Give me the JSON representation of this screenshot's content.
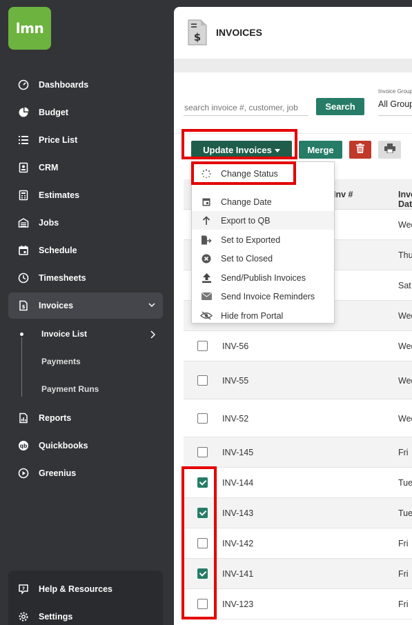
{
  "app": {
    "logo_text": "lmn"
  },
  "sidebar": {
    "items": [
      {
        "label": "Dashboards",
        "icon": "gauge-icon"
      },
      {
        "label": "Budget",
        "icon": "pie-chart-icon"
      },
      {
        "label": "Price List",
        "icon": "list-icon"
      },
      {
        "label": "CRM",
        "icon": "contact-card-icon"
      },
      {
        "label": "Estimates",
        "icon": "calculator-icon"
      },
      {
        "label": "Jobs",
        "icon": "jobs-icon"
      },
      {
        "label": "Schedule",
        "icon": "calendar-icon"
      },
      {
        "label": "Timesheets",
        "icon": "clock-icon"
      },
      {
        "label": "Invoices",
        "icon": "invoice-icon"
      },
      {
        "label": "Reports",
        "icon": "report-icon"
      },
      {
        "label": "Quickbooks",
        "icon": "quickbooks-icon"
      },
      {
        "label": "Greenius",
        "icon": "play-circle-icon"
      }
    ],
    "invoice_sub": [
      "Invoice List",
      "Payments",
      "Payment Runs"
    ],
    "bottom": [
      {
        "label": "Help & Resources",
        "icon": "help-icon"
      },
      {
        "label": "Settings",
        "icon": "gear-icon"
      }
    ]
  },
  "header": {
    "title": "INVOICES"
  },
  "filters": {
    "search_placeholder": "search invoice #, customer, job",
    "search_label": "Search",
    "group_label": "Invoice Group",
    "group_value": "All Groups"
  },
  "toolbar": {
    "update_label": "Update Invoices",
    "merge_label": "Merge"
  },
  "dropdown": [
    {
      "label": "Change Status",
      "icon": "spinner-icon"
    },
    {
      "label": "Change Date",
      "icon": "calendar-icon"
    },
    {
      "label": "Export to QB",
      "icon": "arrow-up-icon"
    },
    {
      "label": "Set to Exported",
      "icon": "export-file-icon"
    },
    {
      "label": "Set to Closed",
      "icon": "close-circle-icon"
    },
    {
      "label": "Send/Publish Invoices",
      "icon": "upload-icon"
    },
    {
      "label": "Send Invoice Reminders",
      "icon": "envelope-icon"
    },
    {
      "label": "Hide from Portal",
      "icon": "eye-slash-icon"
    }
  ],
  "table": {
    "headers": {
      "inv": "Inv #",
      "date": "Invoice Date"
    },
    "rows": [
      {
        "inv": "",
        "date": "Wed",
        "checked": false
      },
      {
        "inv": "",
        "date": "Thu",
        "checked": false
      },
      {
        "inv": "",
        "date": "Sat",
        "checked": false
      },
      {
        "inv": "",
        "date": "Wed",
        "checked": false
      },
      {
        "inv": "INV-56",
        "date": "Wed",
        "checked": false
      },
      {
        "inv": "INV-55",
        "date": "Wed",
        "checked": false
      },
      {
        "inv": "INV-52",
        "date": "Wed",
        "checked": false
      },
      {
        "inv": "INV-145",
        "date": "Fri",
        "checked": false
      },
      {
        "inv": "INV-144",
        "date": "Tue",
        "checked": true
      },
      {
        "inv": "INV-143",
        "date": "Tue",
        "checked": true
      },
      {
        "inv": "INV-142",
        "date": "Fri",
        "checked": false
      },
      {
        "inv": "INV-141",
        "date": "Fri",
        "checked": true
      },
      {
        "inv": "INV-123",
        "date": "Fri",
        "checked": false
      }
    ]
  },
  "colors": {
    "brand_green": "#6db33f",
    "button_green": "#267c66",
    "dark_green": "#1f5d4a",
    "danger": "#c0392b",
    "highlight": "#e40000",
    "sidebar_bg": "#333438"
  }
}
